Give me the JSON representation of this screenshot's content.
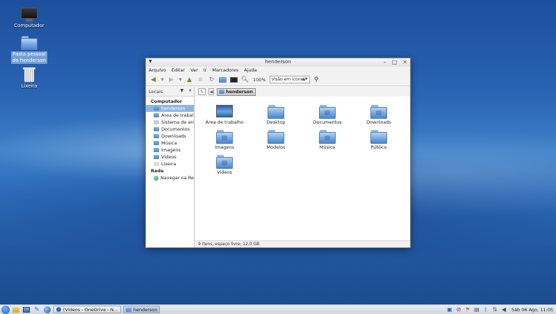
{
  "desktop": {
    "icons": [
      {
        "label": "Computador"
      },
      {
        "label": "Pasta pessoal de henderson"
      },
      {
        "label": "Lixeira"
      }
    ]
  },
  "window": {
    "title": "henderson",
    "menu": [
      "Arquivo",
      "Editar",
      "Ver",
      "Ir",
      "Marcadores",
      "Ajuda"
    ],
    "toolbar": {
      "zoom": "100%",
      "view_mode": "Visão em ícones"
    },
    "sidebar": {
      "header": "Locais",
      "sections": [
        {
          "title": "Computador",
          "items": [
            "henderson",
            "Área de trabalho",
            "Sistema de arq...",
            "Documentos",
            "Downloads",
            "Música",
            "Imagens",
            "Vídeos",
            "Lixeira"
          ]
        },
        {
          "title": "Rede",
          "items": [
            "Navegar na Re..."
          ]
        }
      ],
      "selected": "henderson"
    },
    "location": {
      "current": "henderson"
    },
    "files": [
      {
        "name": "Área de trabalho",
        "icon": "desktop-thumbnail-icon"
      },
      {
        "name": "Desktop",
        "icon": "folder-icon"
      },
      {
        "name": "Documentos",
        "icon": "folder-documents-icon"
      },
      {
        "name": "Downloads",
        "icon": "folder-downloads-icon"
      },
      {
        "name": "Imagens",
        "icon": "folder-pictures-icon"
      },
      {
        "name": "Modelos",
        "icon": "folder-templates-icon"
      },
      {
        "name": "Música",
        "icon": "folder-music-icon"
      },
      {
        "name": "Público",
        "icon": "folder-public-icon"
      },
      {
        "name": "Vídeos",
        "icon": "folder-videos-icon"
      }
    ],
    "status": "9 itens, espaço livre: 12,0 GB"
  },
  "taskbar": {
    "tasks": [
      {
        "label": "[Vídeos - OneDrive - N...",
        "active": false
      },
      {
        "label": "henderson",
        "active": true
      }
    ],
    "clock": "Sáb 06 Ago, 11:05"
  }
}
